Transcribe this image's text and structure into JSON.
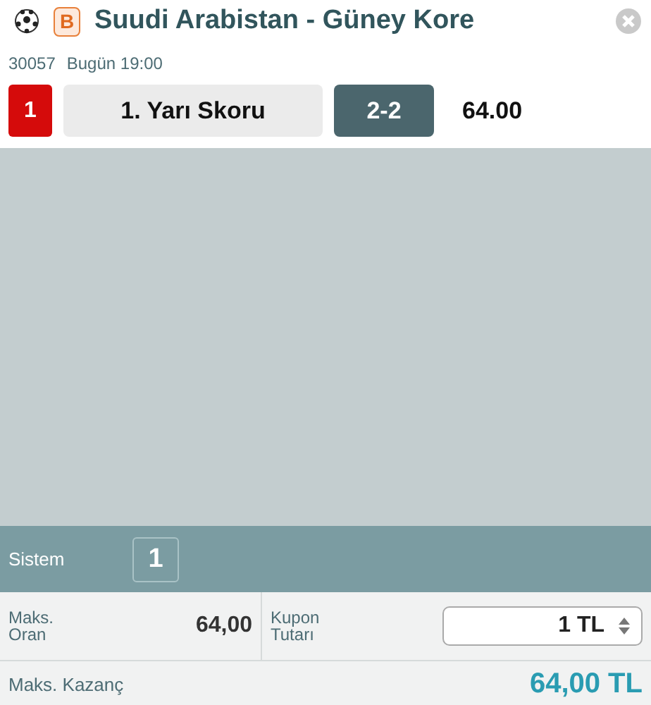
{
  "event": {
    "badge": "B",
    "title": "Suudi Arabistan - Güney Kore",
    "code": "30057",
    "time": "Bugün 19:00"
  },
  "selection": {
    "number": "1",
    "market": "1. Yarı Skoru",
    "pick": "2-2",
    "odds": "64.00"
  },
  "system": {
    "label": "Sistem",
    "value": "1"
  },
  "summary": {
    "max_odds_label": "Maks.\nOran",
    "max_odds": "64,00",
    "stake_label": "Kupon\nTutarı",
    "stake": "1 TL"
  },
  "winnings": {
    "label": "Maks. Kazanç",
    "value": "64,00 TL"
  }
}
